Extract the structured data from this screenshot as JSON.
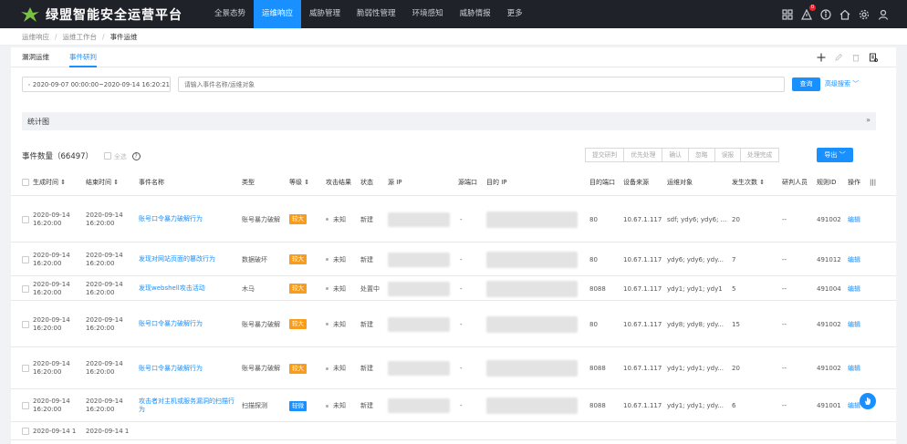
{
  "app": {
    "title": "绿盟智能安全运营平台"
  },
  "nav": {
    "items": [
      {
        "label": "全景态势",
        "active": false
      },
      {
        "label": "运维响应",
        "active": true
      },
      {
        "label": "威胁管理",
        "active": false
      },
      {
        "label": "脆弱性管理",
        "active": false
      },
      {
        "label": "环境感知",
        "active": false
      },
      {
        "label": "威胁情报",
        "active": false
      },
      {
        "label": "更多",
        "active": false
      }
    ],
    "alert_count": "0"
  },
  "breadcrumb": [
    "运维响应",
    "运维工作台",
    "事件运维"
  ],
  "tabs": [
    {
      "label": "漏洞运维",
      "active": false
    },
    {
      "label": "事件研判",
      "active": true
    }
  ],
  "filter": {
    "date_range": "2020-09-07 00:00:00~2020-09-14 16:20:21",
    "search_placeholder": "请输入事件名称/运维对象",
    "query_label": "查询",
    "advanced_label": "高级搜索"
  },
  "stats": {
    "label": "统计图"
  },
  "summary": {
    "count_label": "事件数量（66497）",
    "select_all_label": "全选",
    "actions": [
      "提交研判",
      "优先处理",
      "确认",
      "忽略",
      "误报",
      "处理完成"
    ],
    "export_label": "导出"
  },
  "table": {
    "headers": {
      "gen_time": "生成时间",
      "end_time": "结束时间",
      "name": "事件名称",
      "type": "类型",
      "level": "等级",
      "result": "攻击结果",
      "status": "状态",
      "src_ip": "源 IP",
      "src_port": "源端口",
      "dst_ip": "目的 IP",
      "dst_port": "目的端口",
      "source": "设备来源",
      "object": "运维对象",
      "times": "发生次数",
      "judge": "研判人员",
      "rule": "规则ID",
      "op": "操作"
    },
    "rows": [
      {
        "gen": "2020-09-14 16:20:00",
        "end": "2020-09-14 16:20:00",
        "name": "账号口令暴力破解行为",
        "type": "账号暴力破解",
        "level": "较大",
        "level_kind": "high",
        "result": "未知",
        "status": "新建",
        "src_port": "-",
        "dst_port": "80",
        "source": "10.67.1.117",
        "object": "sdf; ydy6; ydy6; ...",
        "times": "20",
        "judge": "--",
        "rule": "491002",
        "op": "编辑"
      },
      {
        "gen": "2020-09-14 16:20:00",
        "end": "2020-09-14 16:20:00",
        "name": "发现对网站页面的篡改行为",
        "type": "数据破坏",
        "level": "较大",
        "level_kind": "high",
        "result": "未知",
        "status": "新建",
        "src_port": "-",
        "dst_port": "80",
        "source": "10.67.1.117",
        "object": "ydy6; ydy6; ydy...",
        "times": "7",
        "judge": "--",
        "rule": "491012",
        "op": "编辑"
      },
      {
        "gen": "2020-09-14 16:20:00",
        "end": "2020-09-14 16:20:00",
        "name": "发现webshell攻击活动",
        "type": "木马",
        "level": "较大",
        "level_kind": "high",
        "result": "未知",
        "status": "处置中",
        "src_port": "-",
        "dst_port": "8088",
        "source": "10.67.1.117",
        "object": "ydy1; ydy1; ydy1",
        "times": "5",
        "judge": "--",
        "rule": "491004",
        "op": "编辑"
      },
      {
        "gen": "2020-09-14 16:20:00",
        "end": "2020-09-14 16:20:00",
        "name": "账号口令暴力破解行为",
        "type": "账号暴力破解",
        "level": "较大",
        "level_kind": "high",
        "result": "未知",
        "status": "新建",
        "src_port": "-",
        "dst_port": "80",
        "source": "10.67.1.117",
        "object": "ydy8; ydy8; ydy...",
        "times": "15",
        "judge": "--",
        "rule": "491002",
        "op": "编辑"
      },
      {
        "gen": "2020-09-14 16:20:00",
        "end": "2020-09-14 16:20:00",
        "name": "账号口令暴力破解行为",
        "type": "账号暴力破解",
        "level": "较大",
        "level_kind": "high",
        "result": "未知",
        "status": "新建",
        "src_port": "-",
        "dst_port": "8088",
        "source": "10.67.1.117",
        "object": "ydy1; ydy1; ydy...",
        "times": "20",
        "judge": "--",
        "rule": "491002",
        "op": "编辑"
      },
      {
        "gen": "2020-09-14 16:20:00",
        "end": "2020-09-14 16:20:00",
        "name": "攻击者对主机或服务漏洞的扫描行为",
        "type": "扫描探测",
        "level": "轻微",
        "level_kind": "low",
        "result": "未知",
        "status": "新建",
        "src_port": "-",
        "dst_port": "8088",
        "source": "10.67.1.117",
        "object": "ydy1; ydy1; ydy...",
        "times": "6",
        "judge": "--",
        "rule": "491001",
        "op": "编辑"
      },
      {
        "gen": "2020-09-14 1",
        "end": "2020-09-14 1"
      }
    ]
  }
}
